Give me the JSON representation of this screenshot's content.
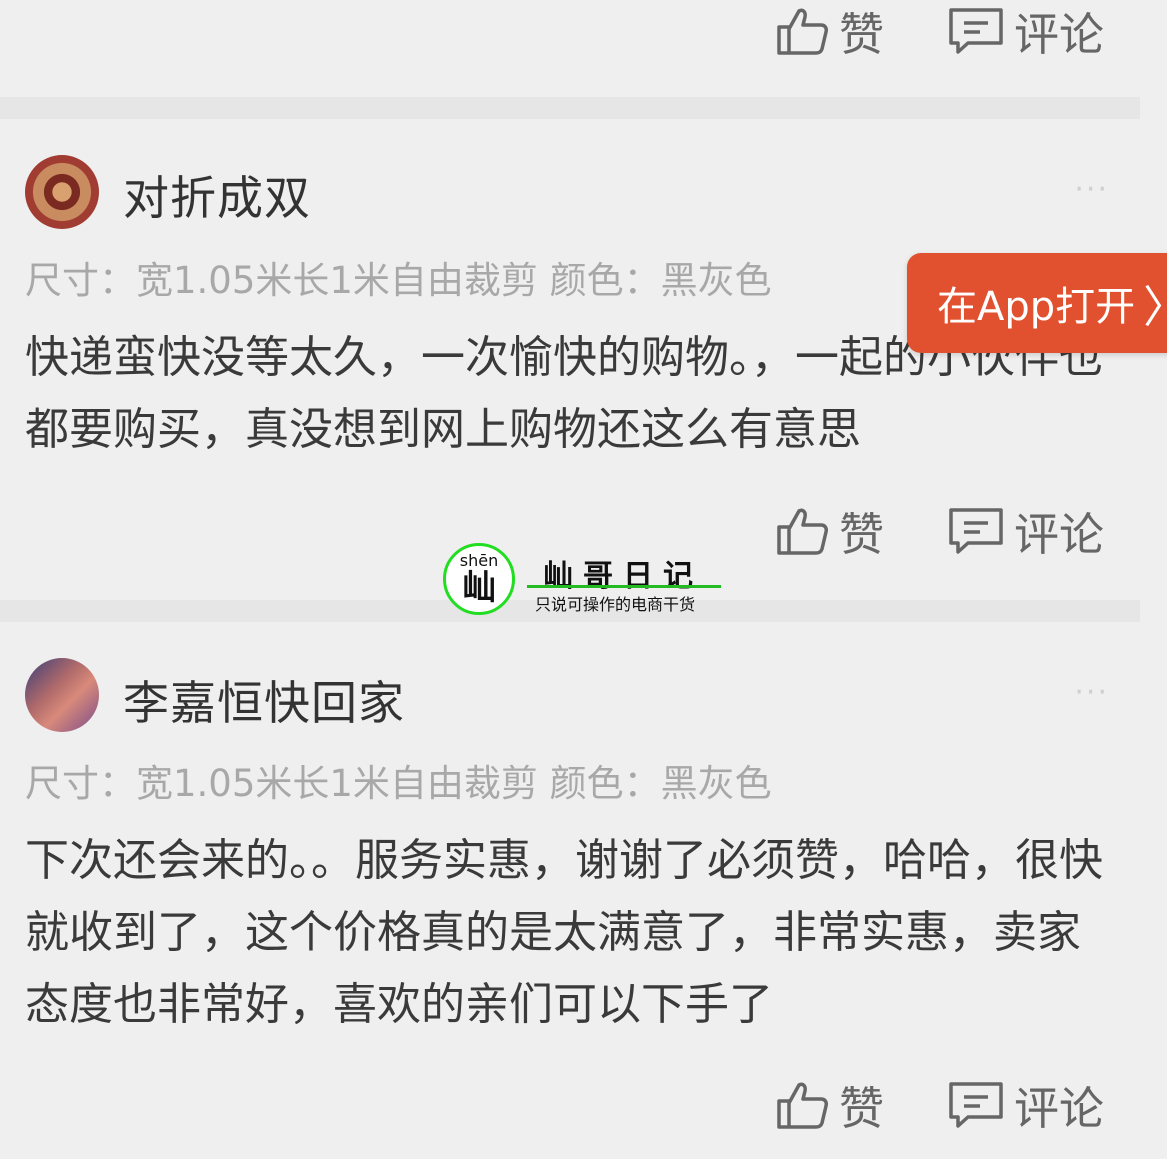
{
  "actions": {
    "like_label": "赞",
    "comment_label": "评论"
  },
  "app_banner": {
    "label": "在App打开",
    "chevron": "〉"
  },
  "reviews": [
    {
      "username": "对折成双",
      "more": "···",
      "spec": "尺寸：宽1.05米长1米自由裁剪 颜色：黑灰色",
      "content": "快递蛮快没等太久，一次愉快的购物。，一起的小伙伴也都要购买，真没想到网上购物还这么有意思"
    },
    {
      "username": "李嘉恒快回家",
      "more": "···",
      "spec": "尺寸：宽1.05米长1米自由裁剪 颜色：黑灰色",
      "content": "下次还会来的。。服务实惠，谢谢了必须赞，哈哈，很快就收到了，这个价格真的是太满意了，非常实惠，卖家态度也非常好，喜欢的亲们可以下手了"
    }
  ],
  "watermark": {
    "pinyin": "shēn",
    "char": "屾",
    "title": "屾哥日记",
    "subtitle": "只说可操作的电商干货"
  },
  "icons": {
    "like": "thumbs-up-icon",
    "comment": "comment-icon",
    "more": "more-dots-icon"
  }
}
